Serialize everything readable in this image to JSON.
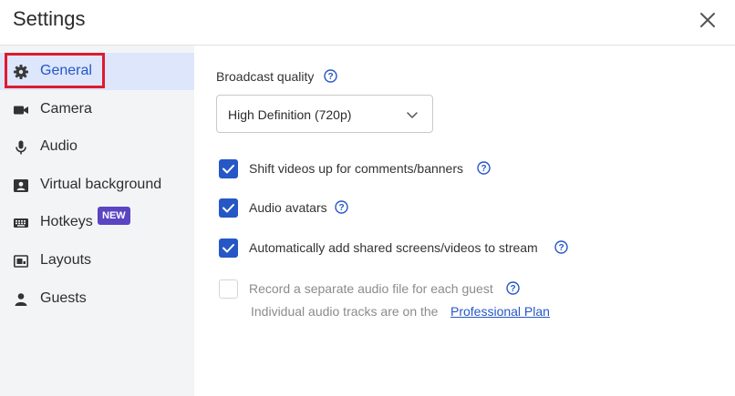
{
  "window": {
    "title": "Settings"
  },
  "sidebar": {
    "items": [
      {
        "label": "General",
        "icon": "gear-icon",
        "active": true
      },
      {
        "label": "Camera",
        "icon": "camera-icon"
      },
      {
        "label": "Audio",
        "icon": "microphone-icon"
      },
      {
        "label": "Virtual background",
        "icon": "portrait-icon"
      },
      {
        "label": "Hotkeys",
        "icon": "keyboard-icon"
      },
      {
        "label": "Layouts",
        "icon": "layout-icon",
        "badge": "NEW"
      },
      {
        "label": "Guests",
        "icon": "person-icon"
      }
    ]
  },
  "general": {
    "broadcast_quality_label": "Broadcast quality",
    "broadcast_quality_value": "High Definition (720p)",
    "options": [
      {
        "label": "Shift videos up for comments/banners",
        "checked": true
      },
      {
        "label": "Audio avatars",
        "checked": true
      },
      {
        "label": "Automatically add shared screens/videos to stream",
        "checked": true
      },
      {
        "label": "Record a separate audio file for each guest",
        "checked": false,
        "disabled": true
      }
    ],
    "upgrade_note": "Individual audio tracks are on the",
    "upgrade_link": "Professional Plan"
  },
  "colors": {
    "accent": "#2557c6",
    "badge": "#5b45c1",
    "highlight_border": "#e0192d",
    "sidebar_bg": "#f3f4f6",
    "active_bg": "#dde6fb"
  }
}
